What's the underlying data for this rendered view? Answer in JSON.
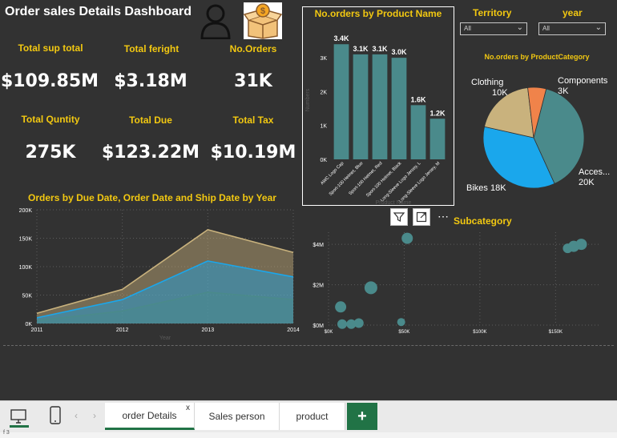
{
  "dashboard": {
    "title": "Order sales Details Dashboard",
    "icons": [
      "person-icon",
      "money-box-icon"
    ]
  },
  "kpis": [
    {
      "label": "Total sup total",
      "value": "$109.85M"
    },
    {
      "label": "Total feright",
      "value": "$3.18M"
    },
    {
      "label": "No.Orders",
      "value": "31K"
    },
    {
      "label": "Total Quntity",
      "value": "275K"
    },
    {
      "label": "Total Due",
      "value": "$123.22M"
    },
    {
      "label": "Total Tax",
      "value": "$10.19M"
    }
  ],
  "slicers": {
    "territory": {
      "label": "Territory",
      "value": "All"
    },
    "year": {
      "label": "year",
      "value": "All"
    }
  },
  "colors": {
    "canvas": "#323232",
    "accent": "#f2c811",
    "teal": "#4a8a8b",
    "blue": "#1aa7ec",
    "tan": "#c9b27d",
    "orange": "#f0834a",
    "tab_active_border": "#217346"
  },
  "bar_chart": {
    "title": "No.orders by Product Name",
    "xlabel": "Product Name",
    "ylabel": "Numbers",
    "chart_data": {
      "type": "bar",
      "categories": [
        "AWC Logo Cap",
        "Sport-100 Helmet, Blue",
        "Sport-100 Helmet, Red",
        "Sport-100 Helmet, Black",
        "Long-Sleeve Logo Jersey, L",
        "Long-Sleeve Logo Jersey, M"
      ],
      "values": [
        3400,
        3100,
        3100,
        3000,
        1600,
        1200
      ],
      "data_labels": [
        "3.4K",
        "3.1K",
        "3.1K",
        "3.0K",
        "1.6K",
        "1.2K"
      ],
      "yticks": [
        "0K",
        "1K",
        "2K",
        "3K"
      ],
      "ylim": [
        0,
        3500
      ]
    }
  },
  "pie_chart": {
    "title": "No.orders by ProductCategory",
    "chart_data": {
      "type": "pie",
      "slices": [
        {
          "name": "Accessories",
          "label": "Acces...",
          "value_label": "20K",
          "value": 20,
          "color": "#4a8a8b"
        },
        {
          "name": "Bikes",
          "label": "Bikes",
          "value_label": "18K",
          "value": 18,
          "color": "#1aa7ec"
        },
        {
          "name": "Clothing",
          "label": "Clothing",
          "value_label": "10K",
          "value": 10,
          "color": "#c9b27d"
        },
        {
          "name": "Components",
          "label": "Components",
          "value_label": "3K",
          "value": 3,
          "color": "#f0834a"
        }
      ]
    }
  },
  "area_chart": {
    "title": "Orders by Due Date, Order Date and Ship Date by Year",
    "xlabel": "Year",
    "chart_data": {
      "type": "area",
      "x": [
        "2011",
        "2012",
        "2013",
        "2014"
      ],
      "ylim": [
        0,
        200000
      ],
      "yticks": [
        "0K",
        "50K",
        "100K",
        "150K",
        "200K"
      ],
      "series": [
        {
          "values": [
            18000,
            60000,
            165000,
            125000
          ],
          "color": "#c9b27d"
        },
        {
          "values": [
            10000,
            42000,
            110000,
            82000
          ],
          "color": "#1aa7ec"
        },
        {
          "values": [
            5000,
            22000,
            55000,
            42000
          ],
          "color": "#4a8a8b"
        }
      ]
    }
  },
  "scatter_chart": {
    "title": "Subcategory",
    "chart_data": {
      "type": "scatter",
      "xticks": [
        "$0K",
        "$50K",
        "$100K",
        "$150K"
      ],
      "yticks": [
        "$0M",
        "$2M",
        "$4M"
      ],
      "xlim": [
        0,
        180000
      ],
      "ylim": [
        0,
        4600000
      ],
      "points": [
        {
          "x": 8000,
          "y": 900000,
          "r": 7
        },
        {
          "x": 9000,
          "y": 50000,
          "r": 6
        },
        {
          "x": 15000,
          "y": 50000,
          "r": 6
        },
        {
          "x": 20000,
          "y": 100000,
          "r": 6
        },
        {
          "x": 28000,
          "y": 1850000,
          "r": 8
        },
        {
          "x": 48000,
          "y": 150000,
          "r": 5
        },
        {
          "x": 52000,
          "y": 4300000,
          "r": 7
        },
        {
          "x": 158000,
          "y": 3800000,
          "r": 6
        },
        {
          "x": 162000,
          "y": 3900000,
          "r": 7
        },
        {
          "x": 167000,
          "y": 4000000,
          "r": 7
        }
      ]
    }
  },
  "visual_header": {
    "filter": "filter-icon",
    "focus": "focus-mode-icon",
    "more": "⋯"
  },
  "tabs": [
    {
      "label": "order Details",
      "active": true,
      "close": "x"
    },
    {
      "label": "Sales person",
      "active": false
    },
    {
      "label": "product",
      "active": false
    }
  ],
  "add_tab": "+",
  "status": {
    "page": "f 3"
  }
}
